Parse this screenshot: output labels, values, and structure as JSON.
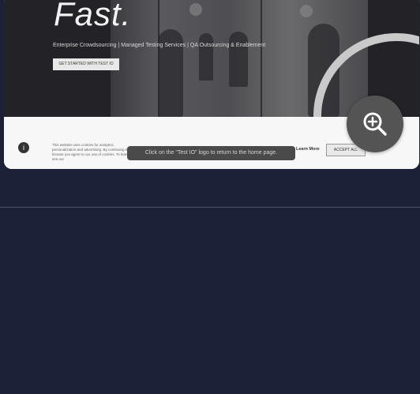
{
  "hero": {
    "title": "Fast.",
    "tagline": "Enterprise Crowdsourcing | Managed Testing Services | QA Outsourcing & Enablement",
    "cta_label": "GET STARTED WITH TEST IO"
  },
  "cookie_banner": {
    "icon": "info-icon",
    "text": "This website uses cookies for analytics, personalization and advertising. By continuing to browse you agree to our use of cookies. To learn more, see our",
    "learn_more": "Learn More",
    "accept_label": "ACCEPT ALL"
  },
  "tooltip": {
    "text": "Click on the \"Test IO\" logo to return to the home page."
  },
  "zoom_button": {
    "icon": "zoom-in-icon"
  },
  "colors": {
    "page_background": "#1d2138",
    "zoom_button": "#545454"
  }
}
